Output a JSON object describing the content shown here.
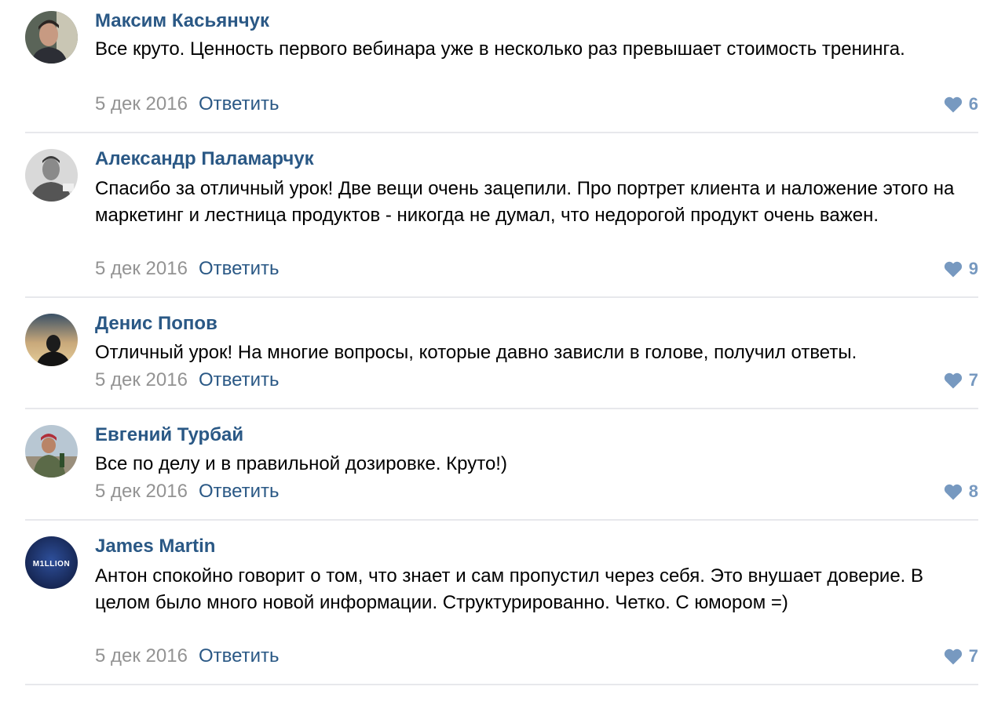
{
  "comments": [
    {
      "author": "Максим Касьянчук",
      "text": "Все круто. Ценность первого вебинара уже в несколько раз превышает стоимость тренинга.",
      "date": "5 дек 2016",
      "reply_label": "Ответить",
      "likes": "6",
      "avatar_icon": "user-photo-avatar"
    },
    {
      "author": "Александр Паламарчук",
      "text": "Спасибо за отличный урок! Две вещи очень зацепили. Про портрет клиента и наложение этого на маркетинг и лестница продуктов - никогда не думал, что недорогой продукт очень важен.",
      "date": "5 дек 2016",
      "reply_label": "Ответить",
      "likes": "9",
      "avatar_icon": "user-photo-avatar"
    },
    {
      "author": "Денис Попов",
      "text": "Отличный урок! На многие вопросы, которые давно зависли в голове, получил ответы.",
      "date": "5 дек 2016",
      "reply_label": "Ответить",
      "likes": "7",
      "avatar_icon": "user-photo-avatar"
    },
    {
      "author": "Евгений Турбай",
      "text": "Все по делу и в правильной дозировке. Круто!)",
      "date": "5 дек 2016",
      "reply_label": "Ответить",
      "likes": "8",
      "avatar_icon": "user-photo-avatar"
    },
    {
      "author": "James Martin",
      "text": "Антон спокойно говорит о том, что знает и сам пропустил через себя. Это внушает доверие. В целом было много новой информации. Структурированно. Четко. С юмором =)",
      "date": "5 дек 2016",
      "reply_label": "Ответить",
      "likes": "7",
      "avatar_icon": "million-logo-avatar",
      "avatar_logo_text": "M1LLION"
    }
  ],
  "colors": {
    "link": "#2a5885",
    "date": "#939393",
    "like": "#7799c0",
    "divider": "#e7e8ec"
  }
}
